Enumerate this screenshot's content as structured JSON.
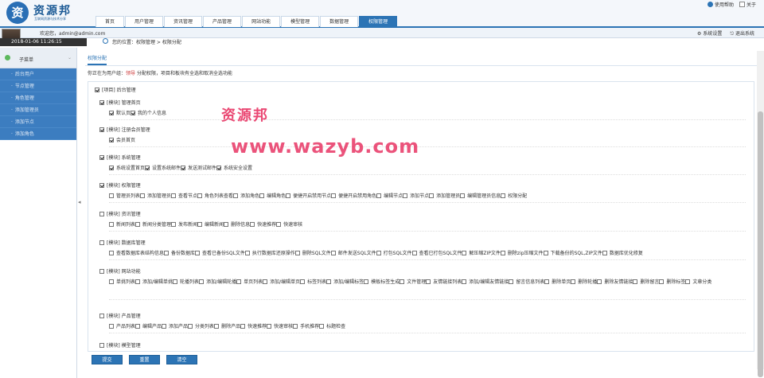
{
  "header": {
    "logo_glyph": "资",
    "logo_title": "资源邦",
    "logo_subtitle": "互联网资源与技术分享",
    "links": [
      "使用帮助",
      "关于"
    ]
  },
  "nav": [
    "首页",
    "用户管理",
    "资讯管理",
    "产品管理",
    "网站功能",
    "模型管理",
    "数据管理",
    "权限管理"
  ],
  "nav_active": 7,
  "bar": {
    "welcome": "欢迎您，admin@admin.com",
    "datetime": "2018-01-06 11:26:15",
    "location": "您的位置：权限管理 > 权限分配",
    "tools": [
      "系统设置",
      "退出系统"
    ]
  },
  "sidebar": {
    "title": "子菜单",
    "items": [
      "后台用户",
      "节点管理",
      "角色管理",
      "添加管理员",
      "添加节点",
      "添加角色"
    ]
  },
  "main": {
    "tab": "权限分配",
    "hint_prefix": "你正在为用户组：",
    "hint_group": "领导",
    "hint_suffix": " 分配权限，项目和板块有全选和取消全选功能"
  },
  "tree": {
    "root": {
      "label": "[项目] 后台管理",
      "checked": true
    },
    "modules": [
      {
        "label": "[模块] 管理首页",
        "checked": true,
        "items": [
          {
            "l": "默认页",
            "c": true
          },
          {
            "l": "我的个人信息",
            "c": true
          }
        ]
      },
      {
        "label": "[模块] 注册会员管理",
        "checked": true,
        "items": [
          {
            "l": "会员首页",
            "c": true
          }
        ]
      },
      {
        "label": "[模块] 系统管理",
        "checked": true,
        "items": [
          {
            "l": "系统设置首页",
            "c": true
          },
          {
            "l": "设置系统邮件",
            "c": true
          },
          {
            "l": "发送测试邮件",
            "c": true
          },
          {
            "l": "系统安全设置",
            "c": true
          }
        ]
      },
      {
        "label": "[模块] 权限管理",
        "checked": true,
        "items": [
          {
            "l": "管理员列表",
            "c": false
          },
          {
            "l": "添加管理员",
            "c": false
          },
          {
            "l": "查看节点",
            "c": false
          },
          {
            "l": "角色列表查看",
            "c": false
          },
          {
            "l": "添加角色",
            "c": false
          },
          {
            "l": "编辑角色",
            "c": false
          },
          {
            "l": "便捷开启禁用节点",
            "c": false
          },
          {
            "l": "便捷开启禁用角色",
            "c": false
          },
          {
            "l": "编辑节点",
            "c": false
          },
          {
            "l": "添加节点",
            "c": false
          },
          {
            "l": "添加管理员",
            "c": false
          },
          {
            "l": "编辑管理员信息",
            "c": false
          },
          {
            "l": "权限分配",
            "c": false
          }
        ]
      },
      {
        "label": "[模块] 资讯管理",
        "checked": false,
        "items": [
          {
            "l": "新闻列表",
            "c": false
          },
          {
            "l": "新闻分类管理",
            "c": false
          },
          {
            "l": "发布新闻",
            "c": false
          },
          {
            "l": "编辑新闻",
            "c": false
          },
          {
            "l": "删除信息",
            "c": false
          },
          {
            "l": "快速推荐",
            "c": false
          },
          {
            "l": "快速审核",
            "c": false
          }
        ]
      },
      {
        "label": "[模块] 数据库管理",
        "checked": false,
        "items": [
          {
            "l": "查看数据库表结构信息",
            "c": false
          },
          {
            "l": "备份数据库",
            "c": false
          },
          {
            "l": "查看已备份SQL文件",
            "c": false
          },
          {
            "l": "执行数据库还原操作",
            "c": false
          },
          {
            "l": "删除SQL文件",
            "c": false
          },
          {
            "l": "邮件发送SQL文件",
            "c": false
          },
          {
            "l": "打包SQL文件",
            "c": false
          },
          {
            "l": "查看已打包SQL文件",
            "c": false
          },
          {
            "l": "解压缩ZIP文件",
            "c": false
          },
          {
            "l": "删除zip压缩文件",
            "c": false
          },
          {
            "l": "下载备份的SQL,ZIP文件",
            "c": false
          },
          {
            "l": "数据库优化修复",
            "c": false
          }
        ]
      },
      {
        "label": "[模块] 网站功能",
        "checked": false,
        "items": [
          {
            "l": "单挑列表",
            "c": false
          },
          {
            "l": "添加/编辑单挑",
            "c": false
          },
          {
            "l": "轮播列表",
            "c": false
          },
          {
            "l": "添加/编辑轮播",
            "c": false
          },
          {
            "l": "单页列表",
            "c": false
          },
          {
            "l": "添加/编辑单页",
            "c": false
          },
          {
            "l": "标签列表",
            "c": false
          },
          {
            "l": "添加/编辑标签",
            "c": false
          },
          {
            "l": "模板标签生成",
            "c": false
          },
          {
            "l": "文件管理",
            "c": false
          },
          {
            "l": "友情链接列表",
            "c": false
          },
          {
            "l": "添加/编辑友情链接",
            "c": false
          },
          {
            "l": "留言信息列表",
            "c": false
          },
          {
            "l": "删除单页",
            "c": false
          },
          {
            "l": "删除轮播",
            "c": false
          },
          {
            "l": "删除友情链接",
            "c": false
          },
          {
            "l": "删除留言",
            "c": false
          },
          {
            "l": "删除标签",
            "c": false
          },
          {
            "l": "文章分类",
            "c": false
          }
        ]
      },
      {
        "label": "[模块] 产品管理",
        "checked": false,
        "items": [
          {
            "l": "产品列表",
            "c": false
          },
          {
            "l": "编辑产品",
            "c": false
          },
          {
            "l": "添加产品",
            "c": false
          },
          {
            "l": "分类列表",
            "c": false
          },
          {
            "l": "删除产品",
            "c": false
          },
          {
            "l": "快速推荐",
            "c": false
          },
          {
            "l": "快速审核",
            "c": false
          },
          {
            "l": "手机推荐",
            "c": false
          },
          {
            "l": "标题检查",
            "c": false
          }
        ]
      },
      {
        "label": "[模块] 模型管理",
        "checked": false,
        "items": []
      }
    ]
  },
  "buttons": [
    "提交",
    "重置",
    "清空"
  ],
  "watermark": {
    "line1": "资源邦",
    "line2": "www.wazyb.com"
  }
}
